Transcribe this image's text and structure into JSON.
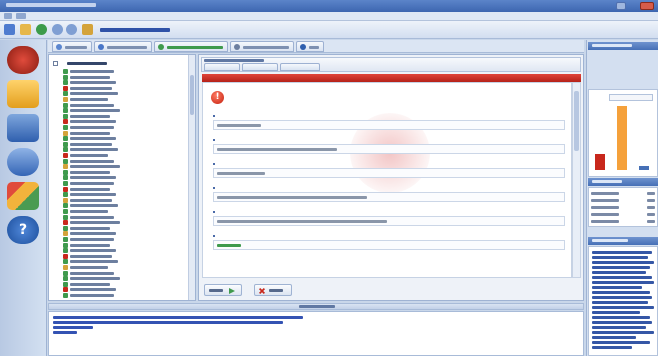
{
  "window": {
    "title": ""
  },
  "menu": {
    "items": [
      "",
      ""
    ]
  },
  "toolbar": {
    "address_link": "",
    "buttons": [
      {
        "label": "",
        "icon": "back-icon"
      },
      {
        "label": "",
        "icon": "search-icon"
      },
      {
        "label": "",
        "icon": "check-icon"
      },
      {
        "label": "",
        "icon": "filter-icon"
      },
      {
        "label": "",
        "icon": "go-icon"
      }
    ]
  },
  "sidebar": {
    "icons": [
      "home-icon",
      "folder-icon",
      "tools-icon",
      "magnify-icon",
      "cube-icon",
      "help-icon"
    ]
  },
  "tree": {
    "root_label": "",
    "rows": [
      "",
      "",
      "",
      "",
      "",
      "",
      "",
      "",
      "",
      "",
      "",
      "",
      "",
      "",
      "",
      "",
      "",
      "",
      "",
      "",
      "",
      "",
      "",
      "",
      "",
      "",
      "",
      "",
      "",
      "",
      "",
      "",
      "",
      "",
      "",
      "",
      "",
      "",
      "",
      "",
      ""
    ]
  },
  "detail": {
    "header_title": "",
    "tabs": [
      "",
      "",
      ""
    ],
    "section_title": "",
    "alert_title": "",
    "fields": [
      {
        "label": "",
        "value": ""
      },
      {
        "label": "",
        "value": ""
      },
      {
        "label": "",
        "value": ""
      },
      {
        "label": "",
        "value": ""
      },
      {
        "label": "",
        "value": ""
      },
      {
        "label": "",
        "value": ""
      }
    ],
    "watermark_text": "",
    "buttons": {
      "prev_label": "",
      "next_label": ""
    }
  },
  "right_panel": {
    "chart_title": "",
    "stats_title": "",
    "stats": [
      {
        "key": "",
        "value": ""
      },
      {
        "key": "",
        "value": ""
      },
      {
        "key": "",
        "value": ""
      },
      {
        "key": "",
        "value": ""
      },
      {
        "key": "",
        "value": ""
      }
    ],
    "help_title": "",
    "help_lines": [
      "",
      "",
      "",
      "",
      "",
      "",
      "",
      "",
      "",
      "",
      "",
      "",
      "",
      "",
      "",
      "",
      "",
      "",
      "",
      ""
    ]
  },
  "log": {
    "title": "",
    "lines": [
      "",
      "",
      "",
      ""
    ]
  },
  "colors": {
    "accent": "#3d66b0",
    "alert": "#c4210f",
    "chart_orange": "#f5a13b",
    "chart_red": "#c8281c"
  }
}
